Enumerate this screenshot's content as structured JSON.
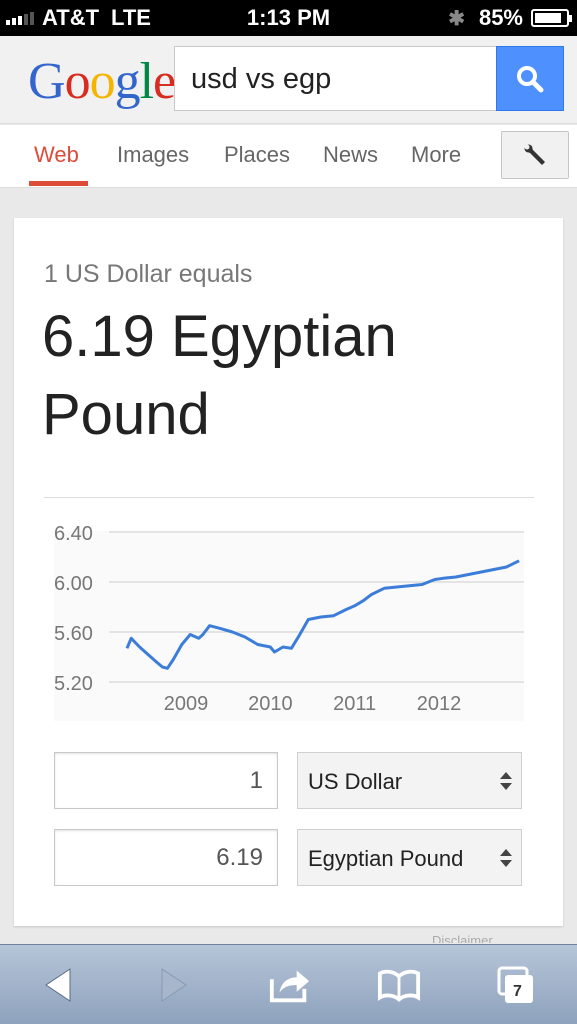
{
  "status_bar": {
    "carrier": "AT&T",
    "network": "LTE",
    "time": "1:13 PM",
    "battery": "85%"
  },
  "header": {
    "logo": "Google",
    "search_value": "usd vs egp"
  },
  "tabs": [
    "Web",
    "Images",
    "Places",
    "News",
    "More"
  ],
  "active_tab": "Web",
  "converter": {
    "equals_label": "1 US Dollar equals",
    "result": "6.19 Egyptian Pound",
    "from_amount": "1",
    "from_currency": "US Dollar",
    "to_amount": "6.19",
    "to_currency": "Egyptian Pound"
  },
  "peek_text": "Disclaimer",
  "toolbar": {
    "tabs_count": "7"
  },
  "colors": {
    "accent_red": "#dd4b39",
    "search_blue": "#4d90fe",
    "line_blue": "#3b7dd8"
  },
  "chart_data": {
    "type": "line",
    "y_ticks": [
      "6.40",
      "6.00",
      "5.60",
      "5.20"
    ],
    "x_ticks": [
      "2009",
      "2010",
      "2011",
      "2012"
    ],
    "ylim": [
      5.2,
      6.4
    ],
    "series": [
      {
        "x": [
          2008.3,
          2008.35,
          2008.45,
          2008.55,
          2008.65,
          2008.72,
          2008.78,
          2008.85,
          2008.95,
          2009.05,
          2009.15,
          2009.2,
          2009.28,
          2009.4,
          2009.55,
          2009.7,
          2009.85,
          2010.0,
          2010.05,
          2010.15,
          2010.25,
          2010.35,
          2010.45,
          2010.6,
          2010.75,
          2010.9,
          2011.0,
          2011.1,
          2011.2,
          2011.35,
          2011.5,
          2011.65,
          2011.8,
          2011.95,
          2012.05,
          2012.2,
          2012.35,
          2012.5,
          2012.65,
          2012.8,
          2012.95
        ],
        "y": [
          5.47,
          5.55,
          5.48,
          5.42,
          5.36,
          5.32,
          5.31,
          5.38,
          5.5,
          5.58,
          5.55,
          5.58,
          5.65,
          5.63,
          5.6,
          5.56,
          5.5,
          5.48,
          5.44,
          5.48,
          5.47,
          5.58,
          5.7,
          5.72,
          5.73,
          5.78,
          5.81,
          5.85,
          5.9,
          5.95,
          5.96,
          5.97,
          5.98,
          6.02,
          6.03,
          6.04,
          6.06,
          6.08,
          6.1,
          6.12,
          6.17
        ]
      }
    ]
  }
}
